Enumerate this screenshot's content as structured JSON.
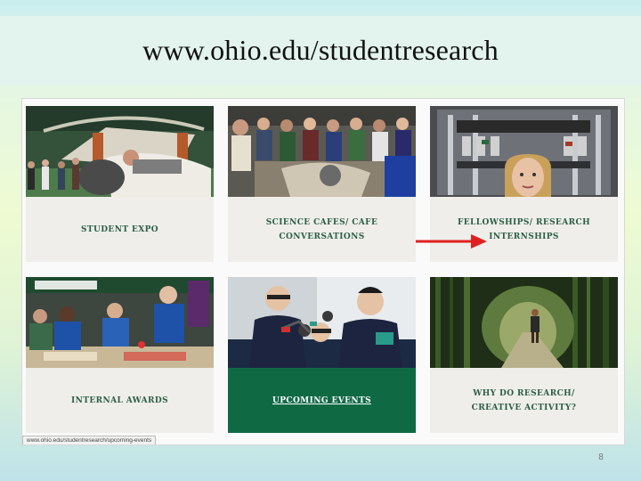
{
  "slide": {
    "title": "www.ohio.edu/studentresearch",
    "page_number": "8"
  },
  "tiles": [
    {
      "label": "STUDENT EXPO"
    },
    {
      "label": "SCIENCE CAFES/ CAFE CONVERSATIONS"
    },
    {
      "label": "FELLOWSHIPS/ RESEARCH INTERNSHIPS"
    },
    {
      "label": "INTERNAL AWARDS"
    },
    {
      "label": "UPCOMING EVENTS"
    },
    {
      "label": "WHY DO RESEARCH/ CREATIVE ACTIVITY?"
    }
  ],
  "status_bar": {
    "url": "www.ohio.edu/studentresearch/upcoming-events"
  },
  "colors": {
    "ohio_green": "#0f6a44",
    "caption_text": "#2c5f45",
    "arrow": "#e02020"
  }
}
